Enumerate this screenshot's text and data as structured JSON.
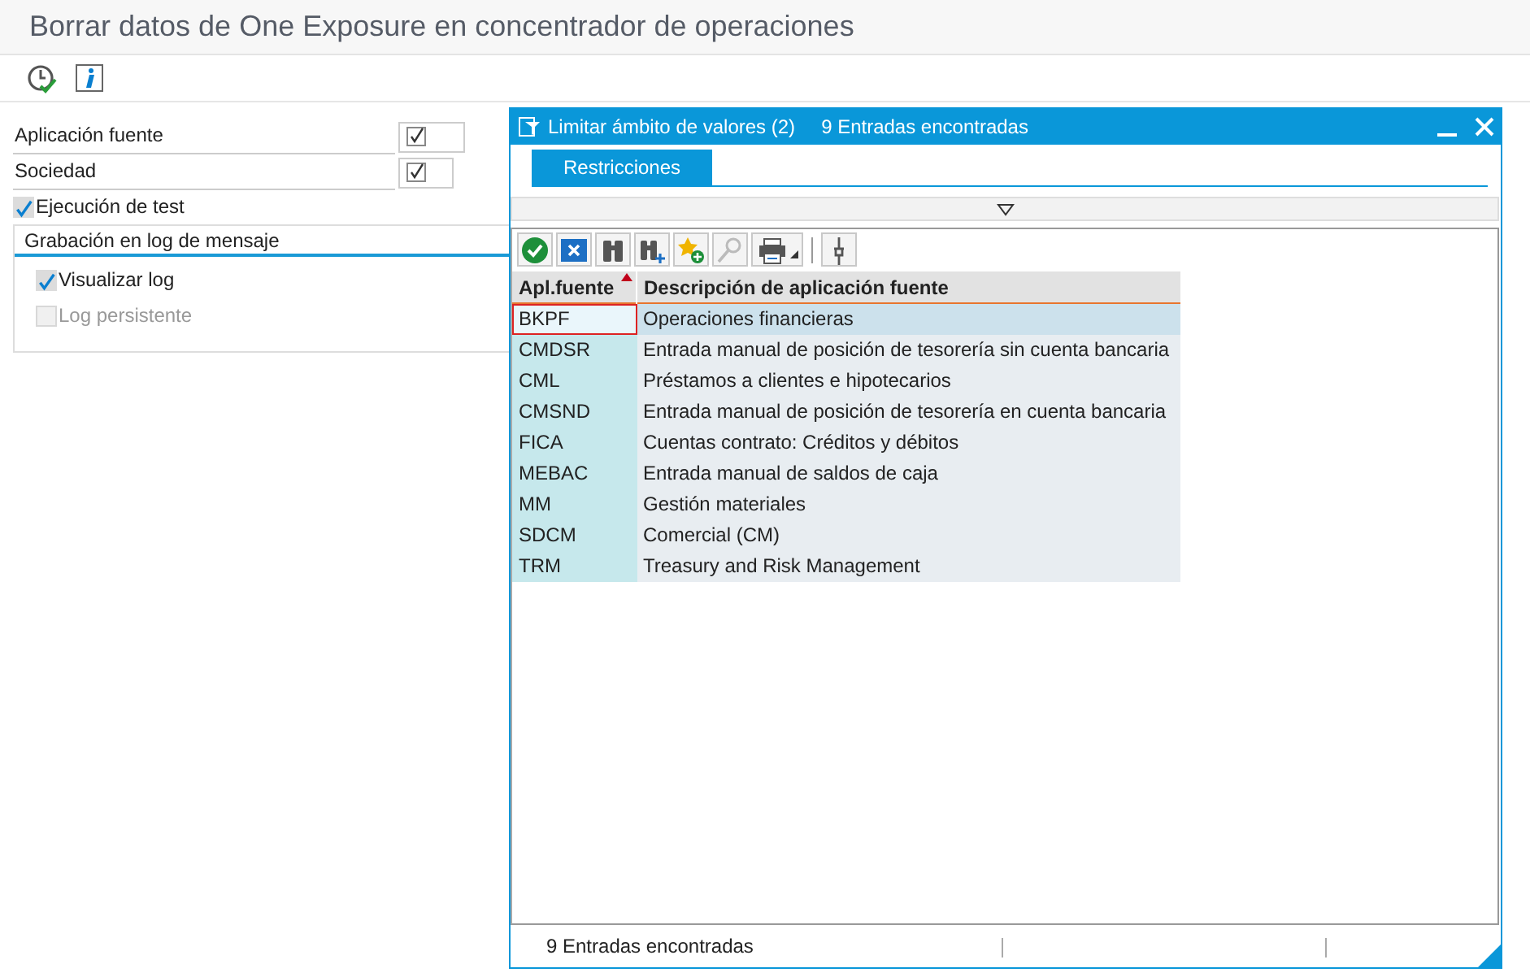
{
  "window": {
    "title": "Borrar datos de One Exposure en concentrador de operaciones"
  },
  "fields": [
    {
      "label": "Aplicación fuente",
      "required": true
    },
    {
      "label": "Sociedad",
      "required": true
    }
  ],
  "options": [
    {
      "label": "Ejecución de test",
      "checked": true,
      "disabled": false
    }
  ],
  "group": {
    "title": "Grabación en log de mensaje",
    "options": [
      {
        "label": "Visualizar log",
        "checked": true,
        "disabled": false
      },
      {
        "label": "Log persistente",
        "checked": false,
        "disabled": true
      }
    ]
  },
  "dialog": {
    "title": "Limitar ámbito de valores (2)",
    "count": "9 Entradas encontradas",
    "tabs": [
      {
        "label": "Restricciones",
        "selected": true
      }
    ],
    "table": {
      "columns": [
        {
          "label": "Apl.fuente",
          "sorted": true
        },
        {
          "label": "Descripción de aplicación fuente",
          "sorted": false
        }
      ],
      "rows": [
        {
          "cells": [
            "BKPF",
            "Operaciones financieras"
          ],
          "selected": true
        },
        {
          "cells": [
            "CMDSR",
            "Entrada manual de posición de tesorería sin cuenta bancaria"
          ],
          "selected": false
        },
        {
          "cells": [
            "CML",
            "Préstamos a clientes e hipotecarios"
          ],
          "selected": false
        },
        {
          "cells": [
            "CMSND",
            "Entrada manual de posición de tesorería en cuenta bancaria"
          ],
          "selected": false
        },
        {
          "cells": [
            "FICA",
            "Cuentas contrato: Créditos y débitos"
          ],
          "selected": false
        },
        {
          "cells": [
            "MEBAC",
            "Entrada manual de saldos de caja"
          ],
          "selected": false
        },
        {
          "cells": [
            "MM",
            "Gestión materiales"
          ],
          "selected": false
        },
        {
          "cells": [
            "SDCM",
            "Comercial (CM)"
          ],
          "selected": false
        },
        {
          "cells": [
            "TRM",
            "Treasury and Risk Management"
          ],
          "selected": false
        }
      ]
    },
    "status_bar": "9 Entradas encontradas"
  }
}
